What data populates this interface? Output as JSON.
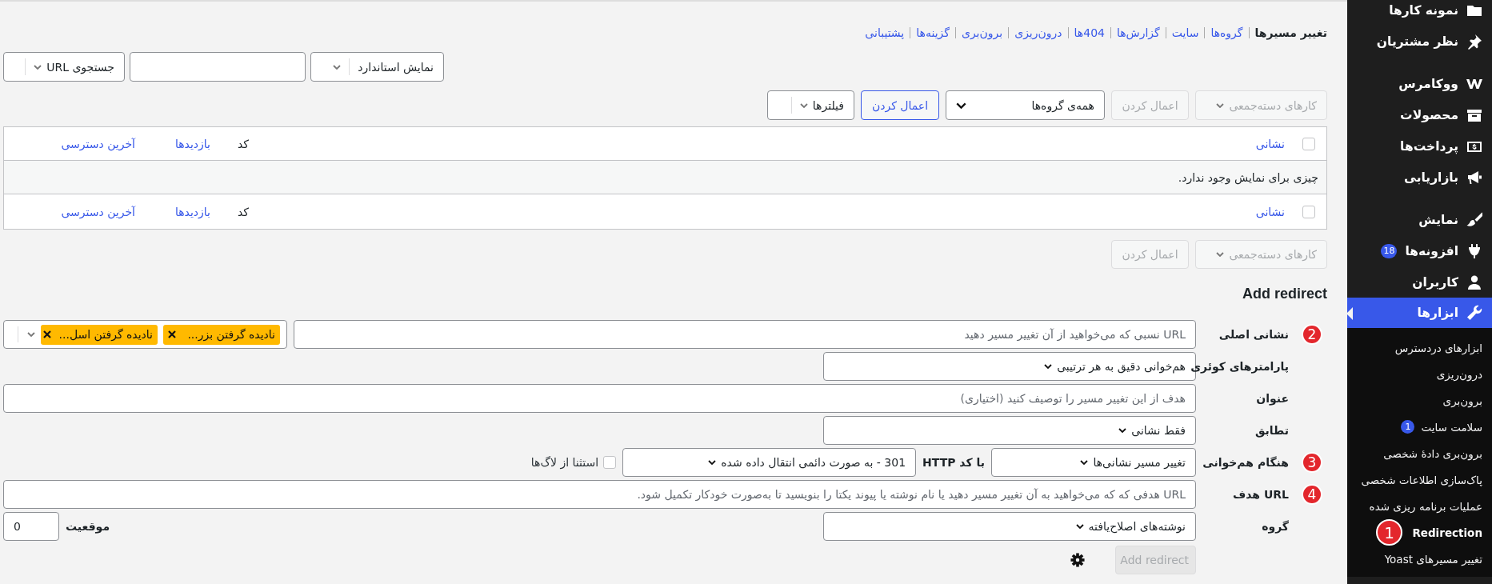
{
  "tabs": [
    {
      "label": "تغییر مسیرها",
      "selected": true
    },
    {
      "label": "گروه‌ها",
      "selected": false
    },
    {
      "label": "سایت",
      "selected": false
    },
    {
      "label": "گزارش‌ها",
      "selected": false
    },
    {
      "label": "404‌ها",
      "selected": false
    },
    {
      "label": "درون‌ریزی",
      "selected": false
    },
    {
      "label": "برون‌بری",
      "selected": false
    },
    {
      "label": "گزینه‌ها",
      "selected": false
    },
    {
      "label": "پشتیبانی",
      "selected": false
    }
  ],
  "search": {
    "view_select": "نمایش استاندارد",
    "button": "جستجوی URL"
  },
  "bulk_top": {
    "bulk_select": {
      "label": "کارهای دسته‌جمعی",
      "disabled": true
    },
    "apply": {
      "label": "اعمال کردن",
      "disabled": true
    },
    "group_select": "همه‌ی گروه‌ها",
    "filter_apply": "اعمال کردن",
    "filters": "فیلترها"
  },
  "table": {
    "header_checked": false,
    "header_columns": [
      "نشانی",
      "کد",
      "بازدیدها",
      "آخرین دسترسی"
    ],
    "empty_message": "چیزی برای نمایش وجود ندارد.",
    "footer_checked": false,
    "footer_columns": [
      "نشانی",
      "کد",
      "بازدیدها",
      "آخرین دسترسی"
    ]
  },
  "bulk_bottom": {
    "bulk_select": {
      "label": "کارهای دسته‌جمعی",
      "disabled": true
    },
    "apply": {
      "label": "اعمال کردن",
      "disabled": true
    }
  },
  "form": {
    "title": "Add redirect",
    "rows": [
      {
        "kind": "source",
        "label": "نشانی اصلی",
        "marker": "2",
        "placeholder": "URL نسبی که می‌خواهید از آن تغییر مسیر دهید",
        "tags": [
          "نادیده گرفتن بزر...",
          "نادیده گرفتن اسل..."
        ]
      },
      {
        "kind": "select",
        "label": "پارامترهای کوئری",
        "value": "هم‌خوانی دقیق به هر ترتیبی"
      },
      {
        "kind": "text",
        "label": "عنوان",
        "placeholder": "هدف از این تغییر مسیر را توصیف کنید (اختیاری)"
      },
      {
        "kind": "select",
        "label": "تطابق",
        "value": "فقط نشانی"
      },
      {
        "kind": "action",
        "label": "هنگام هم‌خوانی",
        "marker": "3",
        "value": "تغییر مسیر نشانی‌ها",
        "code_label": "با کد HTTP",
        "code_value": "301 - به صورت دائمی انتقال داده شده",
        "exclude_label": "استثنا از لاگ‌ها",
        "exclude_checked": false
      },
      {
        "kind": "text",
        "label": "URL هدف",
        "marker": "4",
        "placeholder": "URL هدفی که که می‌خواهید به آن تغییر مسیر دهید یا نام نوشته یا پیوند یکتا را بنویسید تا به‌صورت خودکار تکمیل شود."
      },
      {
        "kind": "group",
        "label": "گروه",
        "value": "نوشته‌های اصلاح‌یافته",
        "position_label": "موقعیت",
        "position_value": "0"
      }
    ],
    "submit": {
      "label": "Add redirect",
      "disabled": true
    }
  },
  "sidebar": {
    "menu": [
      {
        "items": [
          {
            "label": "نمونه کارها",
            "selected": false
          },
          {
            "label": "نظر مشتریان",
            "selected": false
          }
        ]
      },
      {
        "items": [
          {
            "label": "ووکامرس",
            "selected": false
          },
          {
            "label": "محصولات",
            "selected": false
          },
          {
            "label": "پرداخت‌ها",
            "selected": false
          },
          {
            "label": "بازاریابی",
            "selected": false
          }
        ]
      },
      {
        "items": [
          {
            "label": "نمایش",
            "selected": false
          },
          {
            "label": "افزونه‌ها",
            "badge": "18",
            "selected": false
          },
          {
            "label": "کاربران",
            "selected": false
          },
          {
            "label": "ابزارها",
            "selected": true,
            "children": [
              {
                "label": "ابزارهای دردسترس",
                "selected": false
              },
              {
                "label": "درون‌ریزی",
                "selected": false
              },
              {
                "label": "برون‌بری",
                "selected": false
              },
              {
                "label": "سلامت سایت",
                "badge": "1",
                "selected": false
              },
              {
                "label": "برون‌بری دادهٔ شخصی",
                "selected": false
              },
              {
                "label": "پاک‌سازی اطلاعات شخصی",
                "selected": false
              },
              {
                "label": "عملیات برنامه ریزی شده",
                "selected": false
              },
              {
                "label": "Redirection",
                "marker": "1",
                "selected": true
              },
              {
                "label": "تغییر مسیرهای Yoast",
                "selected": false
              }
            ]
          }
        ]
      }
    ]
  }
}
